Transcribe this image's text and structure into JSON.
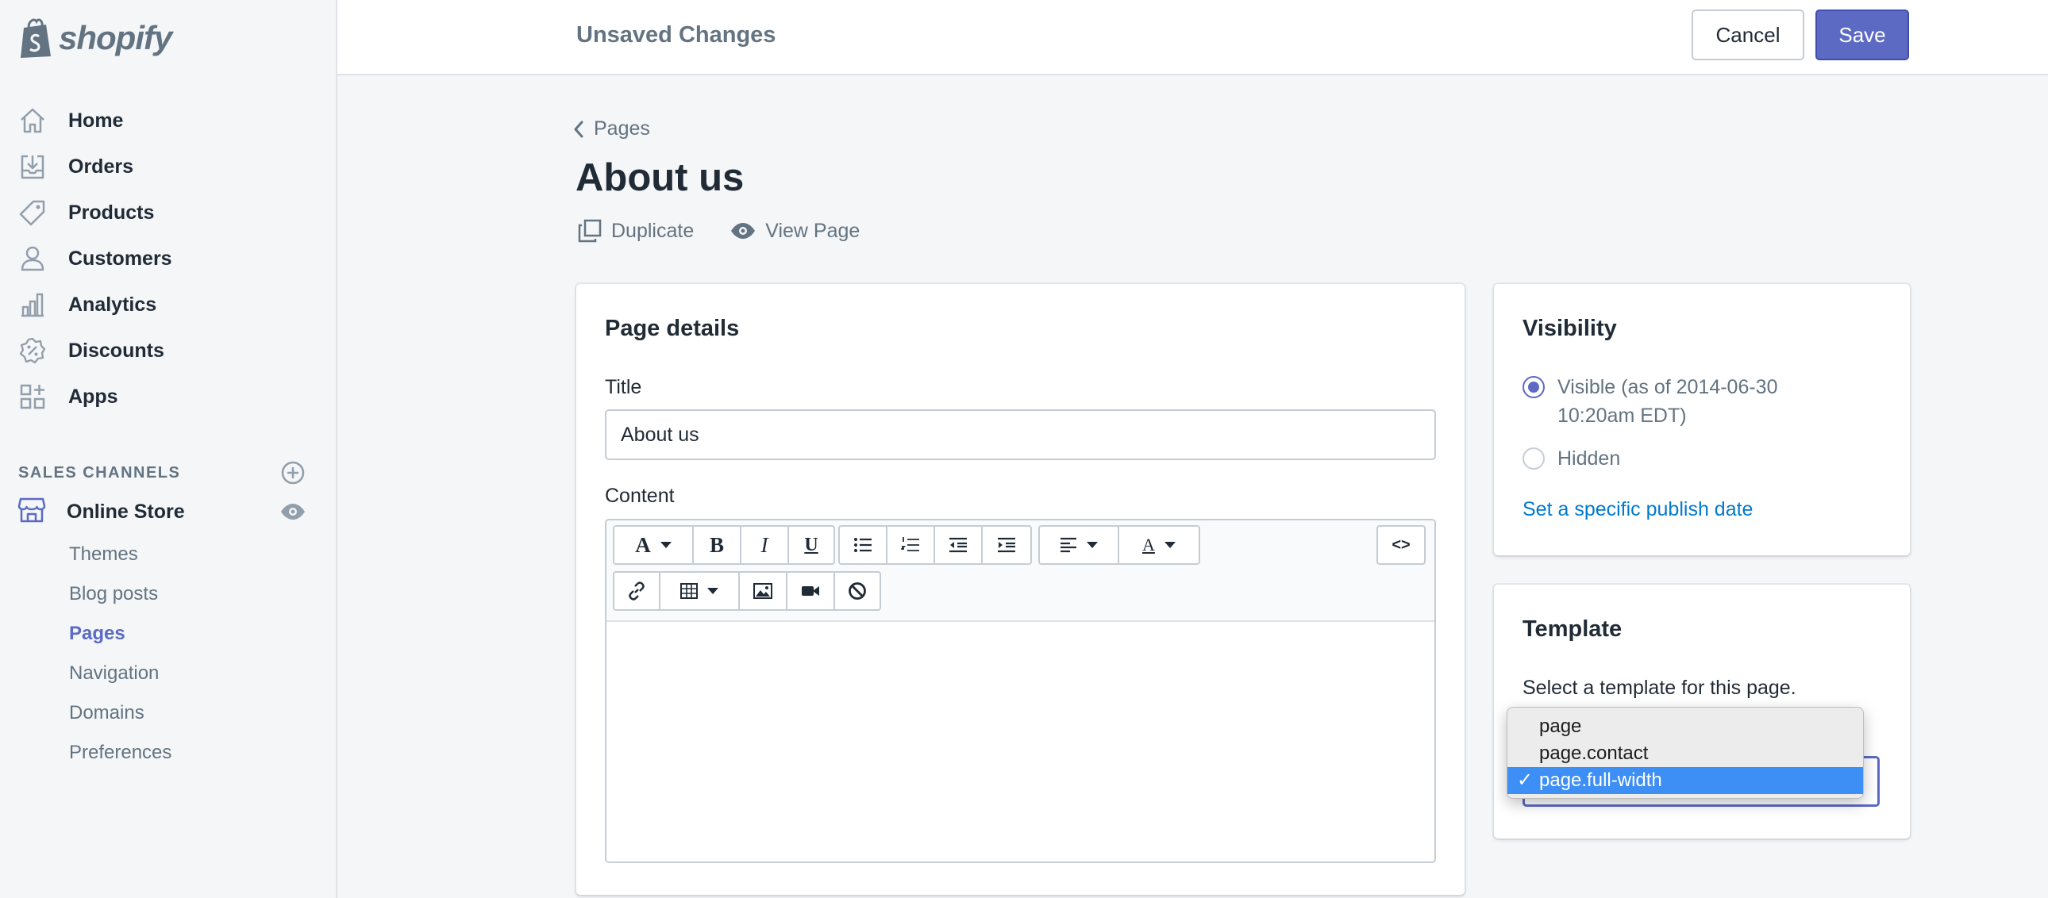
{
  "brand": {
    "name": "shopify"
  },
  "sidebar": {
    "items": [
      {
        "label": "Home",
        "icon": "home-icon"
      },
      {
        "label": "Orders",
        "icon": "orders-icon"
      },
      {
        "label": "Products",
        "icon": "tag-icon"
      },
      {
        "label": "Customers",
        "icon": "person-icon"
      },
      {
        "label": "Analytics",
        "icon": "chart-icon"
      },
      {
        "label": "Discounts",
        "icon": "discount-icon"
      },
      {
        "label": "Apps",
        "icon": "apps-icon"
      }
    ],
    "sales_channels_title": "SALES CHANNELS",
    "online_store": "Online Store",
    "sub_items": [
      "Themes",
      "Blog posts",
      "Pages",
      "Navigation",
      "Domains",
      "Preferences"
    ],
    "active_sub": "Pages"
  },
  "topbar": {
    "title": "Unsaved Changes",
    "cancel": "Cancel",
    "save": "Save"
  },
  "breadcrumb": "Pages",
  "page": {
    "title": "About us",
    "actions": {
      "duplicate": "Duplicate",
      "view": "View Page"
    }
  },
  "details": {
    "heading": "Page details",
    "title_label": "Title",
    "title_value": "About us",
    "content_label": "Content",
    "toolbar": {
      "bold": "B",
      "italic": "I",
      "underline": "U",
      "html": "<>"
    }
  },
  "visibility": {
    "heading": "Visibility",
    "visible_label": "Visible (as of 2014-06-30 10:20am EDT)",
    "hidden_label": "Hidden",
    "selected": "visible",
    "publish_link": "Set a specific publish date"
  },
  "template": {
    "heading": "Template",
    "help": "Select a template for this page.",
    "options": [
      "page",
      "page.contact",
      "page.full-width"
    ],
    "selected": "page.full-width",
    "check": "✓"
  },
  "colors": {
    "accent": "#5c6ac4",
    "link": "#007ace",
    "text": "#212b36",
    "muted": "#637381",
    "highlight": "#3d8ef5"
  }
}
